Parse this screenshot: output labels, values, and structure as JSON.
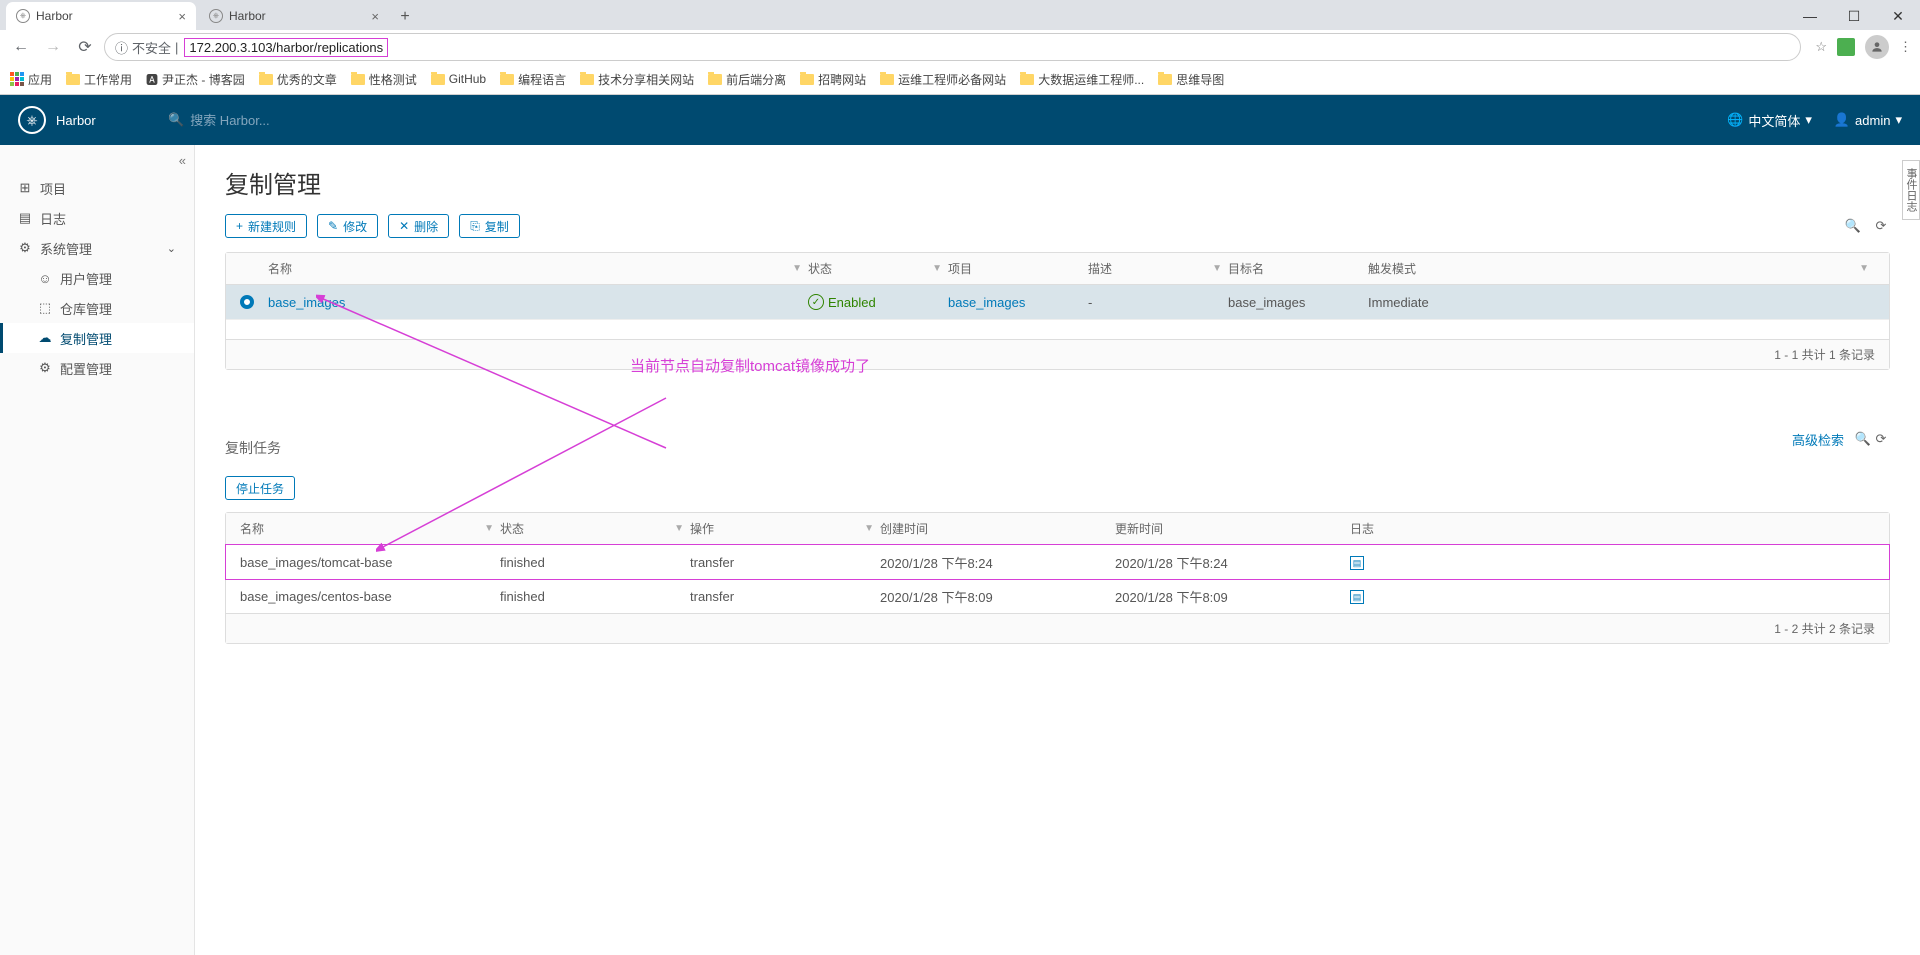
{
  "browser": {
    "tabs": [
      {
        "title": "Harbor",
        "active": true
      },
      {
        "title": "Harbor",
        "active": false
      }
    ],
    "insecure_label": "不安全",
    "url": "172.200.3.103/harbor/replications",
    "bookmarks": [
      {
        "label": "应用",
        "kind": "apps"
      },
      {
        "label": "工作常用",
        "kind": "folder"
      },
      {
        "label": "尹正杰 - 博客园",
        "kind": "link"
      },
      {
        "label": "优秀的文章",
        "kind": "folder"
      },
      {
        "label": "性格测试",
        "kind": "folder"
      },
      {
        "label": "GitHub",
        "kind": "folder"
      },
      {
        "label": "编程语言",
        "kind": "folder"
      },
      {
        "label": "技术分享相关网站",
        "kind": "folder"
      },
      {
        "label": "前后端分离",
        "kind": "folder"
      },
      {
        "label": "招聘网站",
        "kind": "folder"
      },
      {
        "label": "运维工程师必备网站",
        "kind": "folder"
      },
      {
        "label": "大数据运维工程师...",
        "kind": "folder"
      },
      {
        "label": "思维导图",
        "kind": "folder"
      }
    ]
  },
  "header": {
    "brand": "Harbor",
    "search_placeholder": "搜索 Harbor...",
    "language": "中文简体",
    "user": "admin"
  },
  "sidebar": {
    "items": [
      {
        "label": "项目",
        "icon": "⊞"
      },
      {
        "label": "日志",
        "icon": "▤"
      },
      {
        "label": "系统管理",
        "icon": "⚙",
        "expandable": true
      },
      {
        "label": "用户管理",
        "icon": "☺",
        "sub": true
      },
      {
        "label": "仓库管理",
        "icon": "⬚",
        "sub": true
      },
      {
        "label": "复制管理",
        "icon": "☁",
        "sub": true,
        "active": true
      },
      {
        "label": "配置管理",
        "icon": "⚙",
        "sub": true
      }
    ]
  },
  "page": {
    "title": "复制管理",
    "buttons": {
      "new": "新建规则",
      "edit": "修改",
      "delete": "删除",
      "replicate": "复制"
    },
    "rule_table": {
      "headers": {
        "name": "名称",
        "status": "状态",
        "project": "项目",
        "desc": "描述",
        "target": "目标名",
        "trigger": "触发模式"
      },
      "rows": [
        {
          "name": "base_images",
          "status": "Enabled",
          "project": "base_images",
          "desc": "-",
          "target": "base_images",
          "trigger": "Immediate"
        }
      ],
      "footer": "1 - 1 共计 1 条记录"
    },
    "annotation": "当前节点自动复制tomcat镜像成功了",
    "jobs": {
      "title": "复制任务",
      "stop": "停止任务",
      "adv_search": "高级检索",
      "headers": {
        "name": "名称",
        "status": "状态",
        "op": "操作",
        "created": "创建时间",
        "updated": "更新时间",
        "log": "日志"
      },
      "rows": [
        {
          "name": "base_images/tomcat-base",
          "status": "finished",
          "op": "transfer",
          "created": "2020/1/28 下午8:24",
          "updated": "2020/1/28 下午8:24",
          "hl": true
        },
        {
          "name": "base_images/centos-base",
          "status": "finished",
          "op": "transfer",
          "created": "2020/1/28 下午8:09",
          "updated": "2020/1/28 下午8:09"
        }
      ],
      "footer": "1 - 2 共计 2 条记录"
    }
  },
  "side_tab": "事件日志"
}
